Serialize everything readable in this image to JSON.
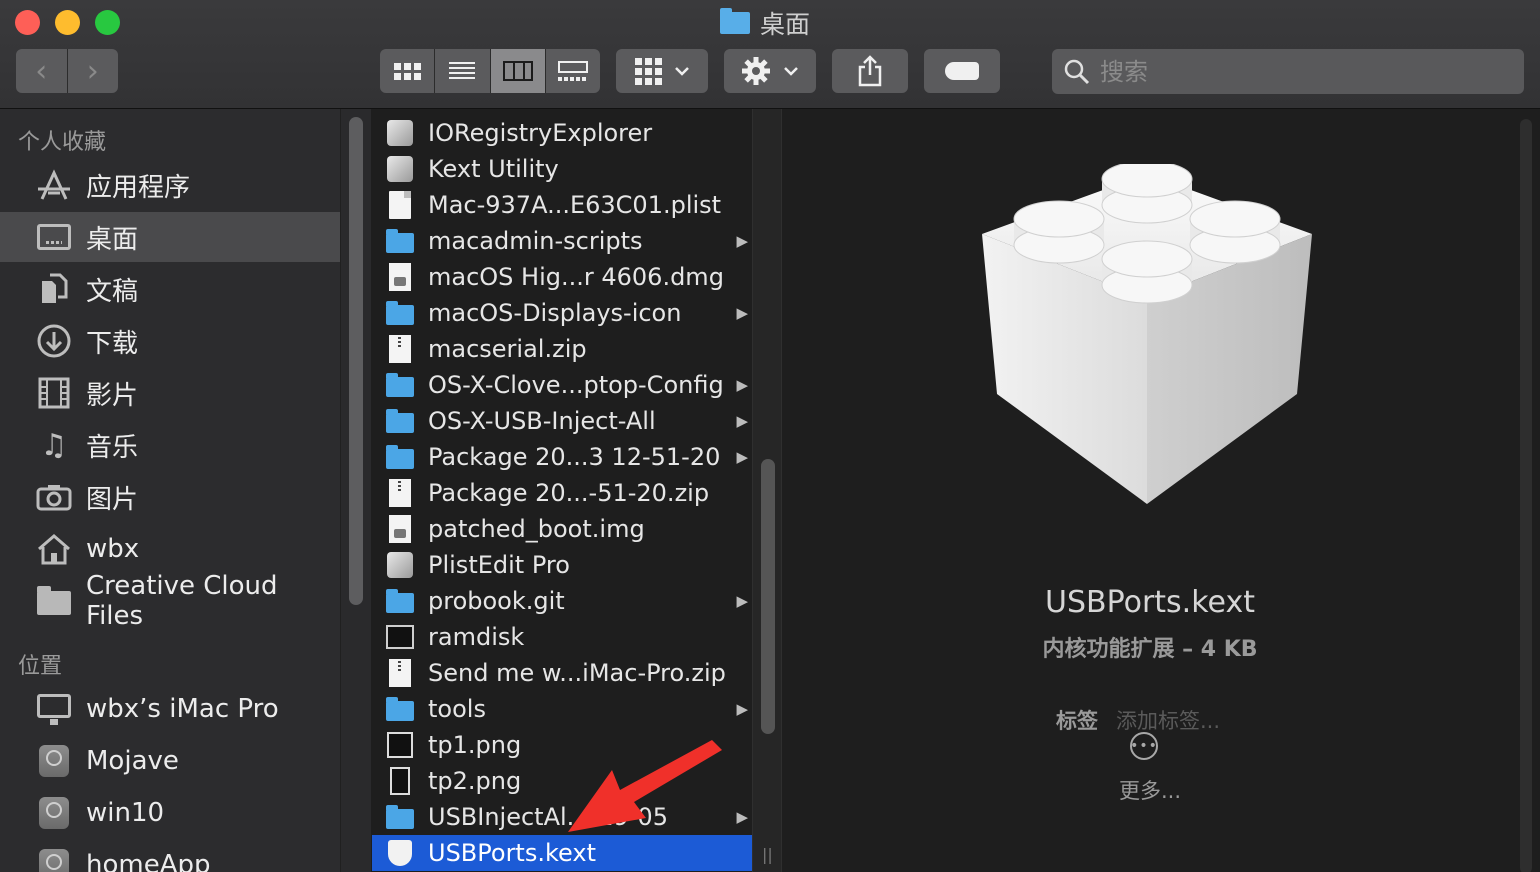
{
  "window": {
    "title": "桌面"
  },
  "toolbar": {
    "back_glyph": "‹",
    "forward_glyph": "›",
    "views": [
      "icon-view",
      "list-view",
      "column-view",
      "gallery-view"
    ],
    "active_view": "column-view"
  },
  "search": {
    "placeholder": "搜索"
  },
  "sidebar": {
    "favorites_heading": "个人收藏",
    "favorites": [
      {
        "label": "应用程序",
        "icon": "apps-icon"
      },
      {
        "label": "桌面",
        "icon": "desktop-icon",
        "selected": true
      },
      {
        "label": "文稿",
        "icon": "documents-icon"
      },
      {
        "label": "下载",
        "icon": "downloads-icon"
      },
      {
        "label": "影片",
        "icon": "movies-icon"
      },
      {
        "label": "音乐",
        "icon": "music-icon"
      },
      {
        "label": "图片",
        "icon": "pictures-icon"
      },
      {
        "label": "wbx",
        "icon": "home-icon"
      },
      {
        "label": "Creative Cloud Files",
        "icon": "folder-icon"
      }
    ],
    "locations_heading": "位置",
    "locations": [
      {
        "label": "wbx’s iMac Pro",
        "icon": "computer-icon"
      },
      {
        "label": "Mojave",
        "icon": "disk-icon"
      },
      {
        "label": "win10",
        "icon": "disk-icon"
      },
      {
        "label": "homeApp",
        "icon": "disk-icon"
      }
    ]
  },
  "files": [
    {
      "name": "IORegistryExplorer",
      "type": "app"
    },
    {
      "name": "Kext Utility",
      "type": "app"
    },
    {
      "name": "Mac-937A...E63C01.plist",
      "type": "doc"
    },
    {
      "name": "macadmin-scripts",
      "type": "folder"
    },
    {
      "name": "macOS Hig...r 4606.dmg",
      "type": "dmg"
    },
    {
      "name": "macOS-Displays-icon",
      "type": "folder"
    },
    {
      "name": "macserial.zip",
      "type": "zip"
    },
    {
      "name": "OS-X-Clove...ptop-Config",
      "type": "folder"
    },
    {
      "name": "OS-X-USB-Inject-All",
      "type": "folder"
    },
    {
      "name": "Package 20...3 12-51-20",
      "type": "folder"
    },
    {
      "name": "Package 20...-51-20.zip",
      "type": "zip"
    },
    {
      "name": "patched_boot.img",
      "type": "dmg"
    },
    {
      "name": "PlistEdit Pro",
      "type": "app"
    },
    {
      "name": "probook.git",
      "type": "folder"
    },
    {
      "name": "ramdisk",
      "type": "terminal"
    },
    {
      "name": "Send me w...iMac-Pro.zip",
      "type": "zip"
    },
    {
      "name": "tools",
      "type": "folder"
    },
    {
      "name": "tp1.png",
      "type": "png"
    },
    {
      "name": "tp2.png",
      "type": "png2"
    },
    {
      "name": "USBInjectAl...-19-05",
      "type": "folder"
    },
    {
      "name": "USBPorts.kext",
      "type": "kext",
      "selected": true
    }
  ],
  "preview": {
    "file_name": "USBPorts.kext",
    "meta": "内核功能扩展 – 4 KB",
    "tags_label": "标签",
    "tags_placeholder": "添加标签...",
    "more_label": "更多..."
  },
  "colors": {
    "selection": "#1c5bd6",
    "folder": "#4ba6e6",
    "annotation_arrow": "#f0302a"
  }
}
